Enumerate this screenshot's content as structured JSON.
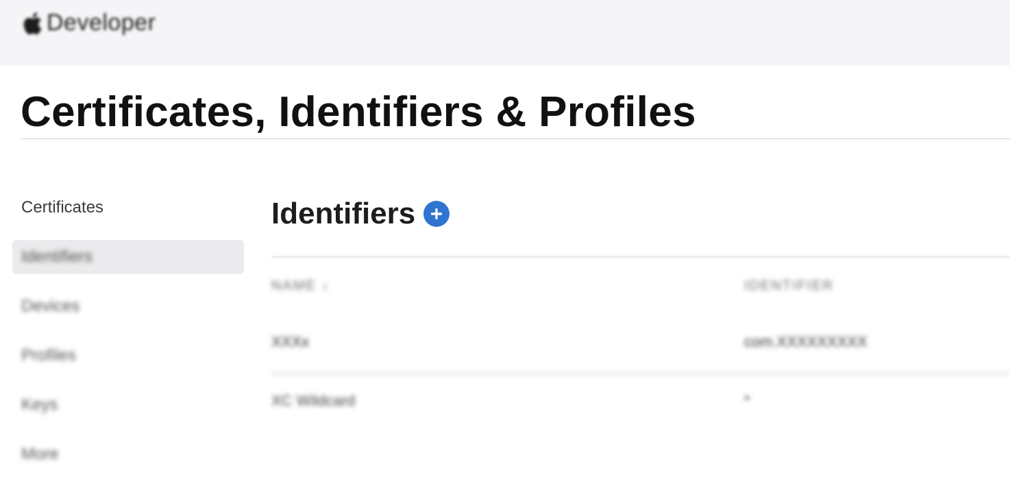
{
  "header": {
    "brand_label": "Developer",
    "logo_icon": "apple-logo-icon"
  },
  "page": {
    "title": "Certificates, Identifiers & Profiles"
  },
  "sidebar": {
    "items": [
      {
        "label": "Certificates"
      },
      {
        "label": "Identifiers"
      },
      {
        "label": "Devices"
      },
      {
        "label": "Profiles"
      },
      {
        "label": "Keys"
      },
      {
        "label": "More"
      }
    ]
  },
  "main": {
    "section_title": "Identifiers",
    "add_icon": "plus-circle-icon",
    "add_color": "#2f74d0",
    "table": {
      "columns": [
        "NAME ↓",
        "IDENTIFIER"
      ],
      "rows": [
        {
          "name": "XXXx",
          "identifier": "com.XXXXXXXXX"
        },
        {
          "name": "XC Wildcard",
          "identifier": "*"
        }
      ]
    }
  }
}
